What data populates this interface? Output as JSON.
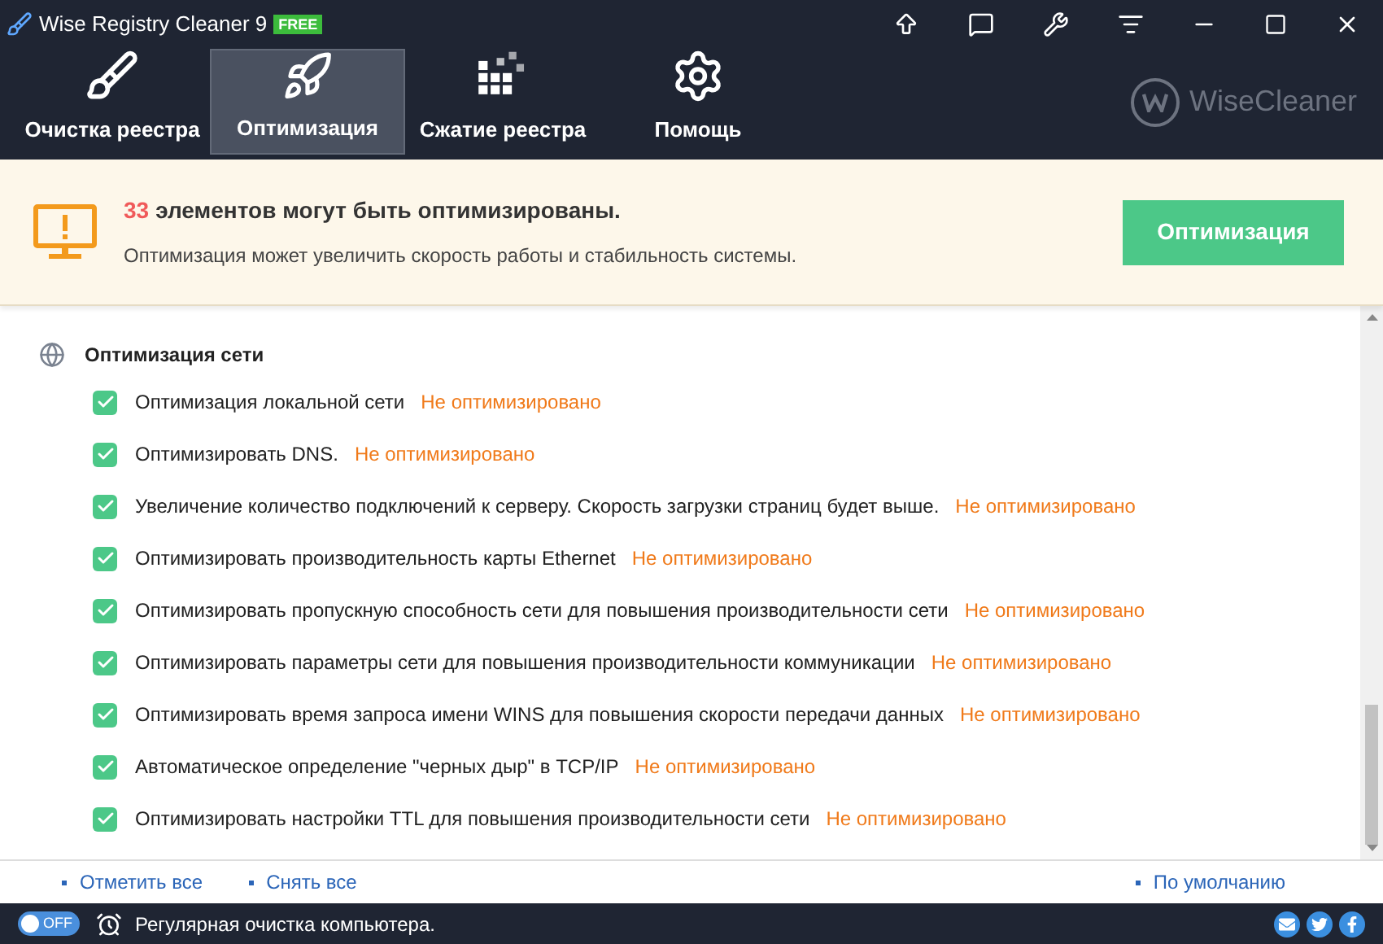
{
  "window": {
    "title": "Wise Registry Cleaner 9",
    "badge": "FREE"
  },
  "tabs": [
    {
      "label": "Очистка реестра",
      "selected": false,
      "kind": "brush"
    },
    {
      "label": "Оптимизация",
      "selected": true,
      "kind": "rocket"
    },
    {
      "label": "Сжатие реестра",
      "selected": false,
      "kind": "blocks"
    },
    {
      "label": "Помощь",
      "selected": false,
      "kind": "gear"
    }
  ],
  "brand": "WiseCleaner",
  "banner": {
    "count": "33",
    "title": "элементов могут быть оптимизированы.",
    "subtitle": "Оптимизация может увеличить скорость работы и стабильность системы.",
    "button": "Оптимизация"
  },
  "section": {
    "title": "Оптимизация сети",
    "items": [
      {
        "label": "Оптимизация локальной сети",
        "status": "Не оптимизировано",
        "checked": true
      },
      {
        "label": "Оптимизировать DNS.",
        "status": "Не оптимизировано",
        "checked": true
      },
      {
        "label": "Увеличение количество подключений к серверу. Скорость загрузки страниц будет выше.",
        "status": "Не оптимизировано",
        "checked": true
      },
      {
        "label": "Оптимизировать производительность карты Ethernet",
        "status": "Не оптимизировано",
        "checked": true
      },
      {
        "label": "Оптимизировать пропускную способность сети для повышения производительности сети",
        "status": "Не оптимизировано",
        "checked": true
      },
      {
        "label": "Оптимизировать параметры сети для повышения производительности коммуникации",
        "status": "Не оптимизировано",
        "checked": true
      },
      {
        "label": "Оптимизировать время запроса имени WINS для повышения скорости передачи данных",
        "status": "Не оптимизировано",
        "checked": true
      },
      {
        "label": "Автоматическое определение \"черных дыр\" в TCP/IP",
        "status": "Не оптимизировано",
        "checked": true
      },
      {
        "label": "Оптимизировать настройки TTL для повышения производительности сети",
        "status": "Не оптимизировано",
        "checked": true
      }
    ]
  },
  "footer_links": [
    "Отметить все",
    "Снять все"
  ],
  "default_link": "По умолчанию",
  "status_bar": {
    "toggle": {
      "label": "OFF",
      "on": false
    },
    "text": "Регулярная очистка компьютера."
  }
}
